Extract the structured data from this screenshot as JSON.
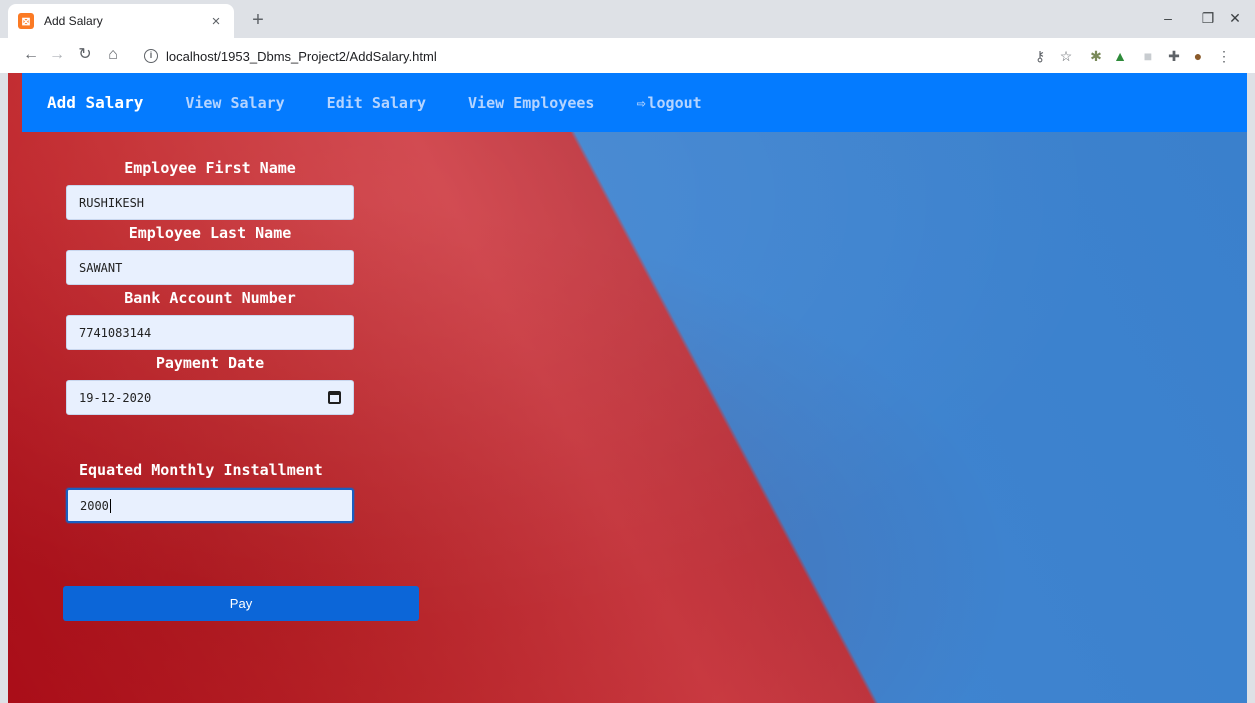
{
  "browser": {
    "tab_title": "Add Salary",
    "tab_close": "×",
    "new_tab": "+",
    "url": "localhost/1953_Dbms_Project2/AddSalary.html",
    "window_controls": {
      "minimize": "–",
      "restore": "❐",
      "close": "✕"
    }
  },
  "navbar": {
    "items": [
      {
        "label": "Add Salary"
      },
      {
        "label": "View Salary"
      },
      {
        "label": "Edit Salary"
      },
      {
        "label": "View Employees"
      },
      {
        "label": "logout"
      }
    ]
  },
  "form": {
    "first_name": {
      "label": "Employee First Name",
      "value": "RUSHIKESH"
    },
    "last_name": {
      "label": "Employee Last Name",
      "value": "SAWANT"
    },
    "bank_account": {
      "label": "Bank Account Number",
      "value": "7741083144"
    },
    "payment_date": {
      "label": "Payment Date",
      "value": "19-12-2020"
    },
    "emi": {
      "label": "Equated Monthly Installment",
      "value": "2000"
    },
    "pay_label": "Pay"
  },
  "colors": {
    "navbar": "#047bff",
    "pay_button": "#0c66d8",
    "input_bg": "#e8f0fe"
  }
}
